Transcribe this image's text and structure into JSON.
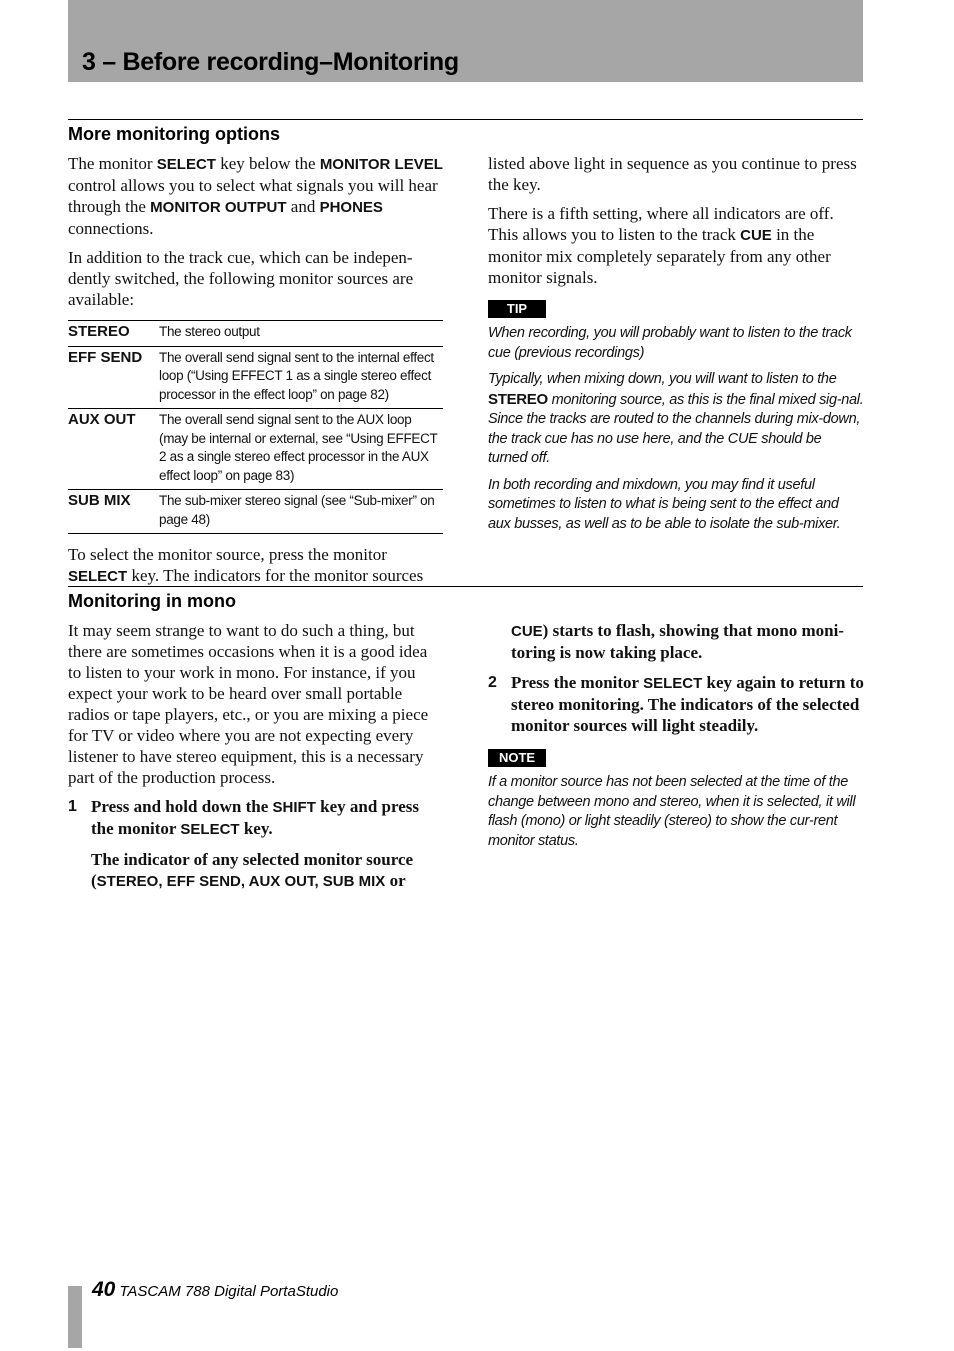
{
  "header": {
    "chapter_title": "3 – Before recording–Monitoring"
  },
  "section1": {
    "title": "More monitoring options",
    "left": {
      "p1": {
        "t1": "The monitor ",
        "k1": "SELECT",
        "t2": " key below the ",
        "k2": "MONITOR LEVEL",
        "t3": " control allows you to select what signals you will hear through the ",
        "k3": "MONITOR OUTPUT",
        "t4": " and ",
        "k4": "PHONES",
        "t5": " connections."
      },
      "p2": "In addition to the track cue, which can be indepen-dently switched, the following monitor sources are available:",
      "sources": [
        {
          "term": "STEREO",
          "description": "The stereo output"
        },
        {
          "term": "EFF SEND",
          "description": "The overall send signal sent to the internal effect loop (“Using EFFECT 1 as a single stereo effect processor in the effect loop” on page 82)"
        },
        {
          "term": "AUX OUT",
          "description": "The overall send signal sent to the AUX loop (may be internal or external, see “Using EFFECT 2 as a single stereo effect processor in the AUX effect loop” on page 83)"
        },
        {
          "term": "SUB MIX",
          "description": "The sub-mixer stereo signal (see “Sub-mixer” on page 48)"
        }
      ],
      "p3": {
        "t1": "To select the monitor source, press the monitor ",
        "k1": "SELECT",
        "t2": " key. The indicators for the monitor sources"
      }
    },
    "right": {
      "p1": "listed above light in sequence as you continue to press the key.",
      "p2": {
        "t1": "There is a fifth setting, where all indicators are off. This allows you to listen to the track ",
        "k1": "CUE",
        "t2": " in the monitor mix completely separately from any other monitor signals."
      },
      "tip_label": "TIP",
      "tip1": "When recording, you will probably want to listen to the track cue (previous recordings)",
      "tip2": {
        "t1": "Typically, when mixing down, you will want to listen to the ",
        "k1": "STEREO",
        "t2": " monitoring source, as this is the final mixed sig-nal. Since the tracks are routed to the channels during mix-down, the track cue has no use here, and the CUE should be turned off."
      },
      "tip3": "In both recording and mixdown, you may find it useful sometimes to listen to what is being sent to the effect and aux busses, as well as to be able to isolate the sub-mixer."
    }
  },
  "section2": {
    "title": "Monitoring in mono",
    "left": {
      "p1": "It may seem strange to want to do such a thing, but there are sometimes occasions when it is a good idea to listen to your work in mono. For instance, if you expect your work to be heard over small portable radios or tape players, etc., or you are mixing a piece for TV or video where you are not expecting every listener to have stereo equipment, this is a necessary part of the production process.",
      "step1": {
        "num": "1",
        "t1": "Press and hold down the ",
        "k1": "SHIFT",
        "t2": " key and press the monitor ",
        "k2": "SELECT",
        "t3": " key."
      },
      "step1_cont": {
        "t1": "The indicator of any selected monitor source (",
        "k1": "STEREO, EFF SEND, AUX OUT, SUB MIX",
        "t2": " or"
      }
    },
    "right": {
      "step1_cont2": {
        "k1": "CUE",
        "t1": ") starts to flash, showing that mono moni-toring is now taking place."
      },
      "step2": {
        "num": "2",
        "t1": "Press the monitor ",
        "k1": "SELECT",
        "t2": " key again to return to stereo monitoring. The indicators of the selected monitor sources will light steadily."
      },
      "note_label": "NOTE",
      "note": "If a monitor source has not been selected at the time of the change between mono and stereo, when it is selected, it will flash (mono) or light steadily (stereo) to show the cur-rent monitor status."
    }
  },
  "footer": {
    "page_number": "40",
    "product": "TASCAM 788 Digital PortaStudio"
  }
}
